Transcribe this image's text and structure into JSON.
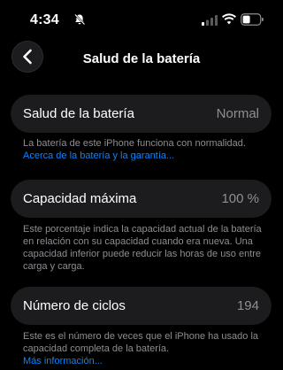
{
  "status_bar": {
    "time": "4:34",
    "icons": [
      "bell-slash-icon",
      "signal-icon",
      "wifi-icon",
      "battery-icon"
    ]
  },
  "nav": {
    "back_icon": "chevron-left-icon",
    "title": "Salud de la batería"
  },
  "sections": {
    "health": {
      "label": "Salud de la batería",
      "value": "Normal",
      "footnote": "La batería de este iPhone funciona con normalidad.",
      "link": "Acerca de la batería y la garantía..."
    },
    "capacity": {
      "label": "Capacidad máxima",
      "value": "100 %",
      "footnote": "Este porcentaje indica la capacidad actual de la batería en relación con su capacidad cuando era nueva. Una capacidad inferior puede reducir las horas de uso entre carga y carga."
    },
    "cycles": {
      "label": "Número de ciclos",
      "value": "194",
      "footnote": "Este es el número de veces que el iPhone ha usado la capacidad completa de la batería.",
      "link": "Más información..."
    }
  },
  "colors": {
    "background": "#000000",
    "cell": "#1c1c1e",
    "secondary_text": "#8e8e93",
    "link": "#0a84ff"
  }
}
